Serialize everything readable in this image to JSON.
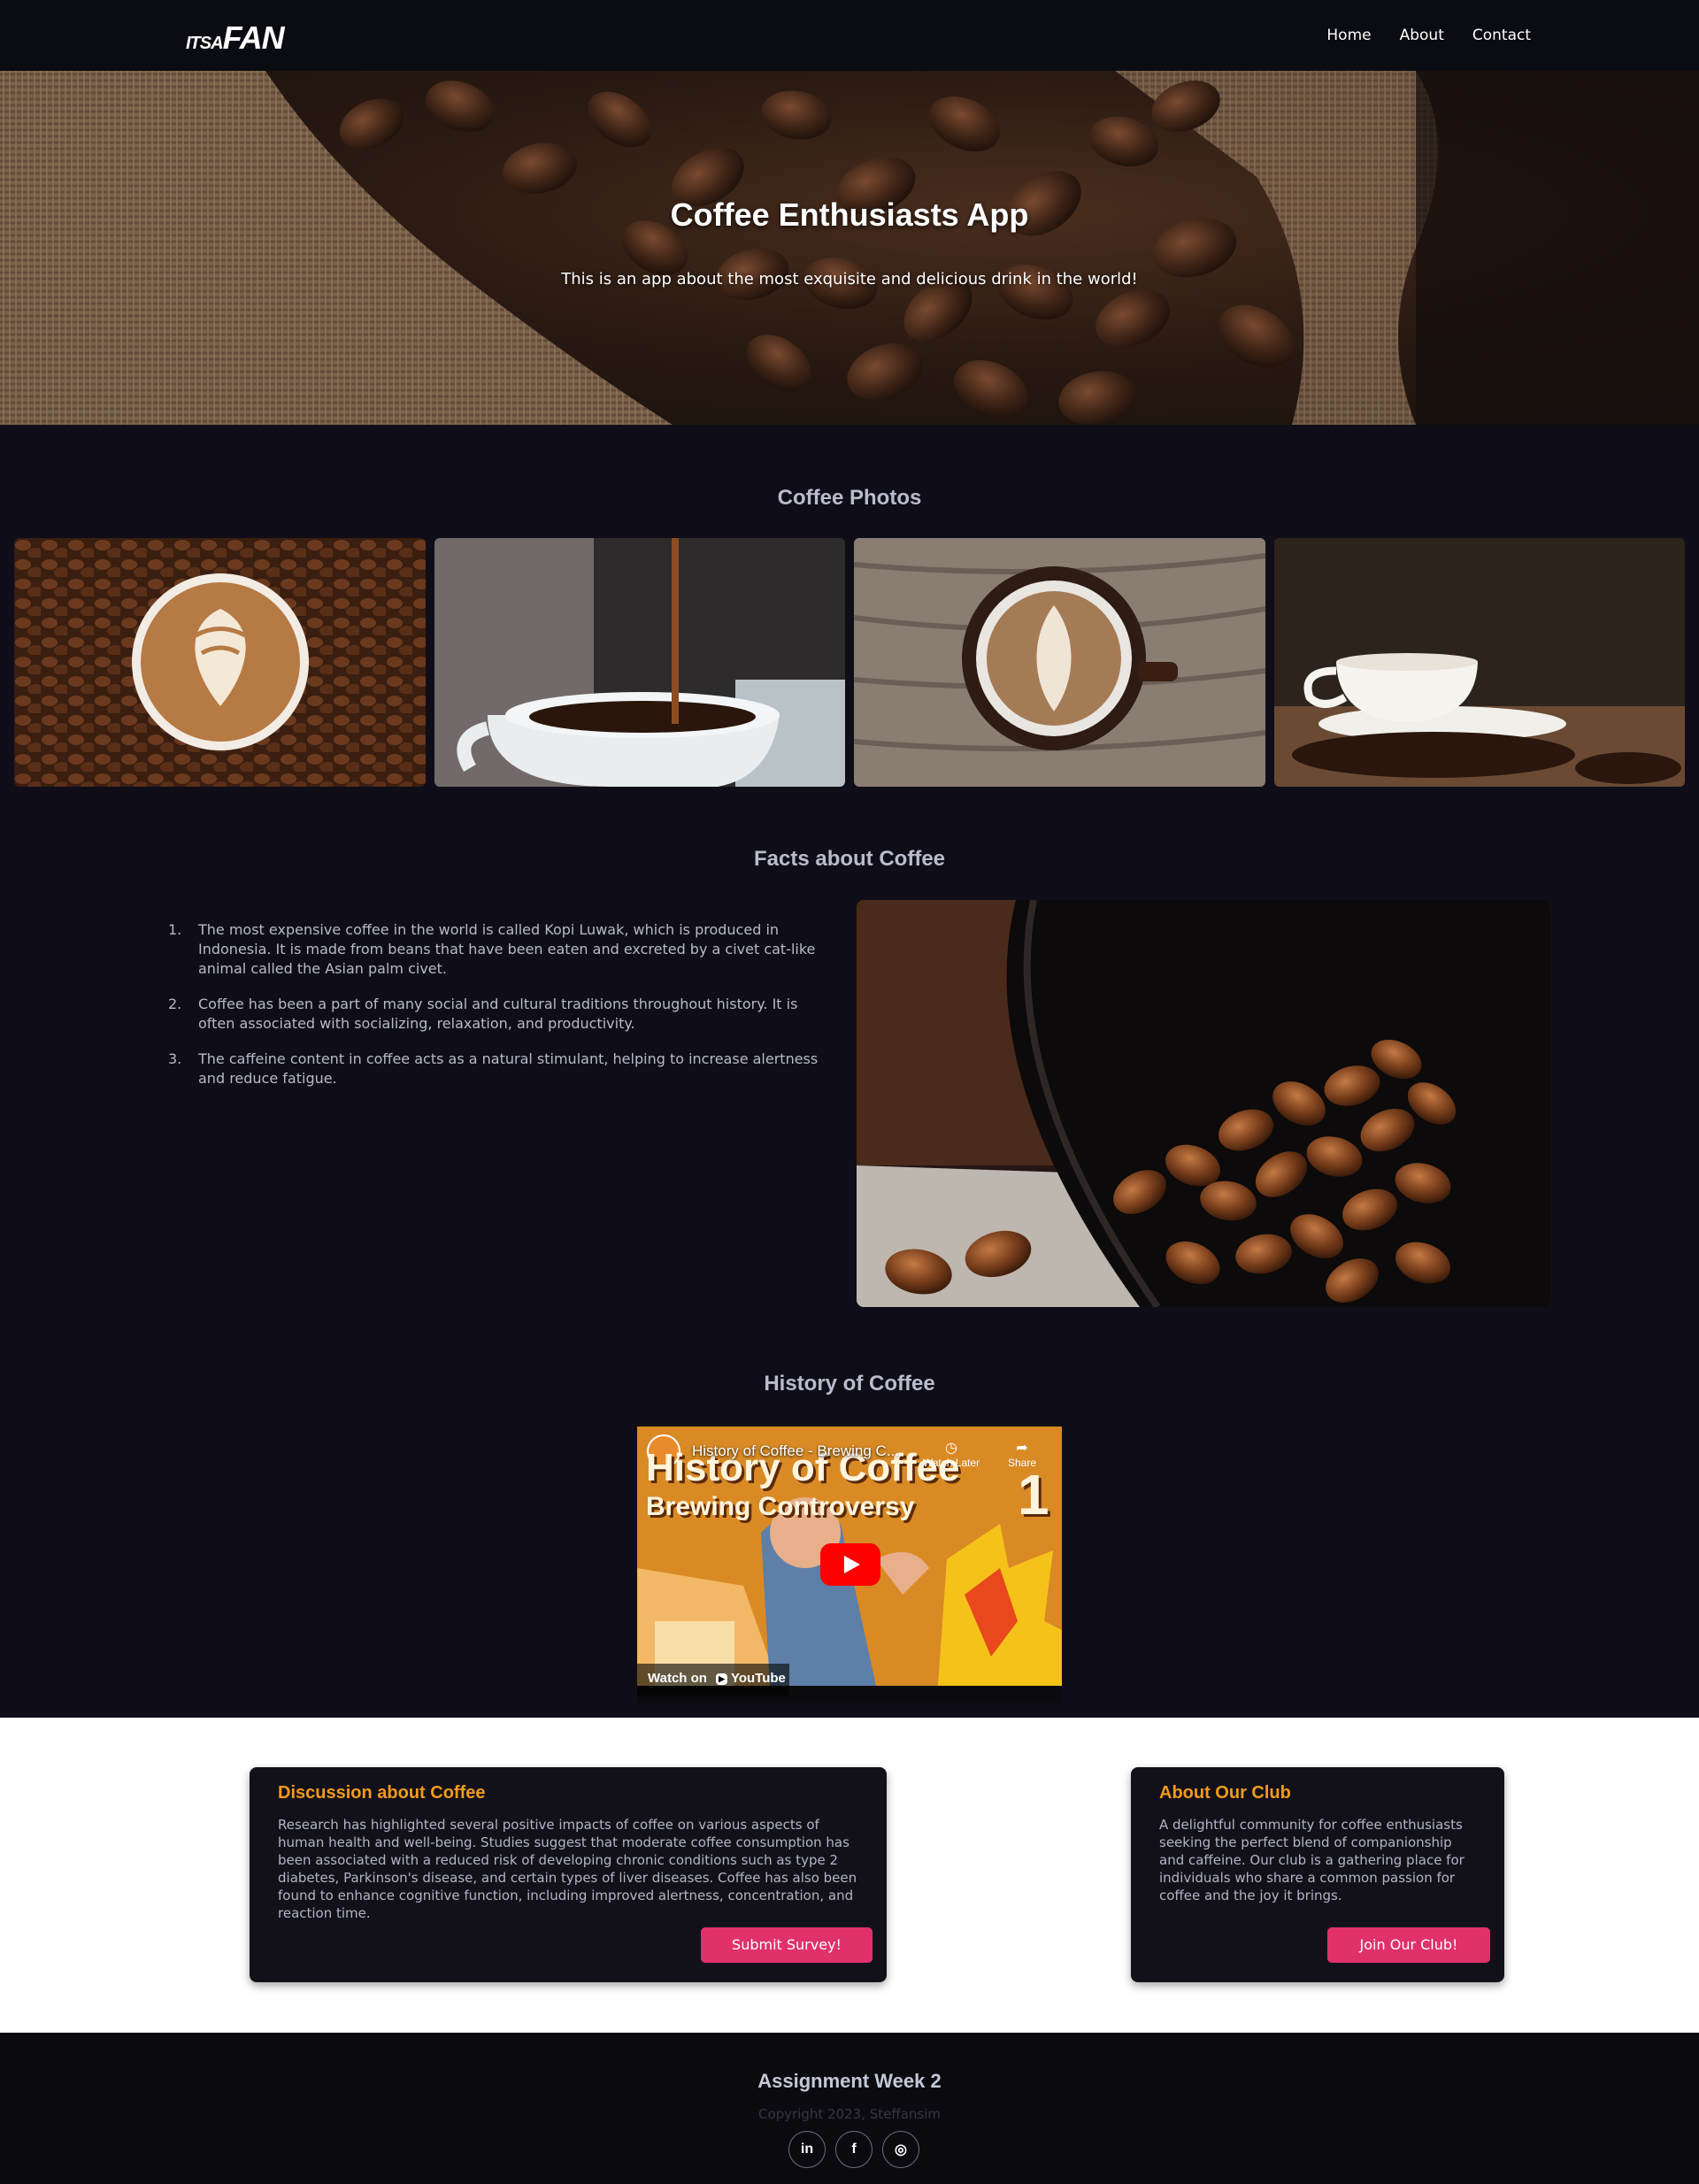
{
  "nav": {
    "logo_small": "ITSA",
    "logo_big": "FAN",
    "links": [
      "Home",
      "About",
      "Contact"
    ]
  },
  "hero": {
    "title": "Coffee Enthusiasts App",
    "subtitle": "This is an app about the most exquisite and delicious drink in the world!"
  },
  "photos": {
    "heading": "Coffee Photos",
    "items": [
      "latte-on-beans-photo",
      "pouring-coffee-photo",
      "latte-art-on-wood-photo",
      "cup-on-saucer-photo"
    ]
  },
  "facts": {
    "heading": "Facts about Coffee",
    "items": [
      {
        "num": "1.",
        "text": "The most expensive coffee in the world is called Kopi Luwak, which is produced in Indonesia. It is made from beans that have been eaten and excreted by a civet cat-like animal called the Asian palm civet."
      },
      {
        "num": "2.",
        "text": "Coffee has been a part of many social and cultural traditions throughout history. It is often associated with socializing, relaxation, and productivity."
      },
      {
        "num": "3.",
        "text": "The caffeine content in coffee acts as a natural stimulant, helping to increase alertness and reduce fatigue."
      }
    ]
  },
  "history": {
    "heading": "History of Coffee",
    "video": {
      "title": "History of Coffee - Brewing C...",
      "watch_later": "Watch Later",
      "share": "Share",
      "thumb_title_1": "History of Coffee",
      "thumb_title_2": "Brewing Controversy",
      "episode": "1",
      "watch_on": "Watch on",
      "platform": "YouTube"
    }
  },
  "cards": {
    "discussion": {
      "title": "Discussion about Coffee",
      "text": "Research has highlighted several positive impacts of coffee on various aspects of human health and well-being. Studies suggest that moderate coffee consumption has been associated with a reduced risk of developing chronic conditions such as type 2 diabetes, Parkinson's disease, and certain types of liver diseases. Coffee has also been found to enhance cognitive function, including improved alertness, concentration, and reaction time.",
      "button": "Submit Survey!"
    },
    "club": {
      "title": "About Our Club",
      "text": "A delightful community for coffee enthusiasts seeking the perfect blend of companionship and caffeine. Our club is a gathering place for individuals who share a common passion for coffee and the joy it brings.",
      "button": "Join Our Club!"
    }
  },
  "footer": {
    "title": "Assignment Week 2",
    "copyright": "Copyright 2023, Steffansim",
    "socials": [
      {
        "name": "linkedin-icon",
        "glyph": "in"
      },
      {
        "name": "facebook-icon",
        "glyph": "f"
      },
      {
        "name": "instagram-icon",
        "glyph": "◎"
      }
    ]
  },
  "colors": {
    "accent_orange": "#f39a1b",
    "button_pink": "#e0316b",
    "page_bg": "#0f0e18"
  }
}
